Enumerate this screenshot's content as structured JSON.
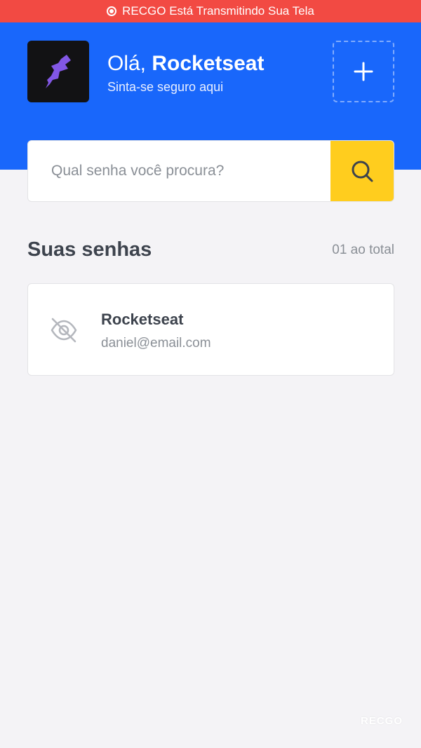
{
  "recording_banner": {
    "text": "RECGO Está Transmitindo Sua Tela"
  },
  "header": {
    "greeting_prefix": "Olá,",
    "user_name": "Rocketseat",
    "subtitle": "Sinta-se seguro aqui",
    "add_icon": "plus-icon"
  },
  "search": {
    "placeholder": "Qual senha você procura?",
    "value": "",
    "button_icon": "search-icon"
  },
  "passwords_section": {
    "title": "Suas senhas",
    "count_text": "01 ao total",
    "items": [
      {
        "name": "Rocketseat",
        "email": "daniel@email.com",
        "icon": "eye-off-icon"
      }
    ]
  },
  "watermark": {
    "text": "RECGO"
  },
  "colors": {
    "recording_bar": "#f24a43",
    "header_bg": "#1967fb",
    "search_button": "#ffcd1e",
    "page_bg": "#f4f3f6",
    "title_text": "#3d434d",
    "muted_text": "#8a8f96",
    "avatar_bg": "#121214",
    "avatar_logo": "#8257e5"
  }
}
